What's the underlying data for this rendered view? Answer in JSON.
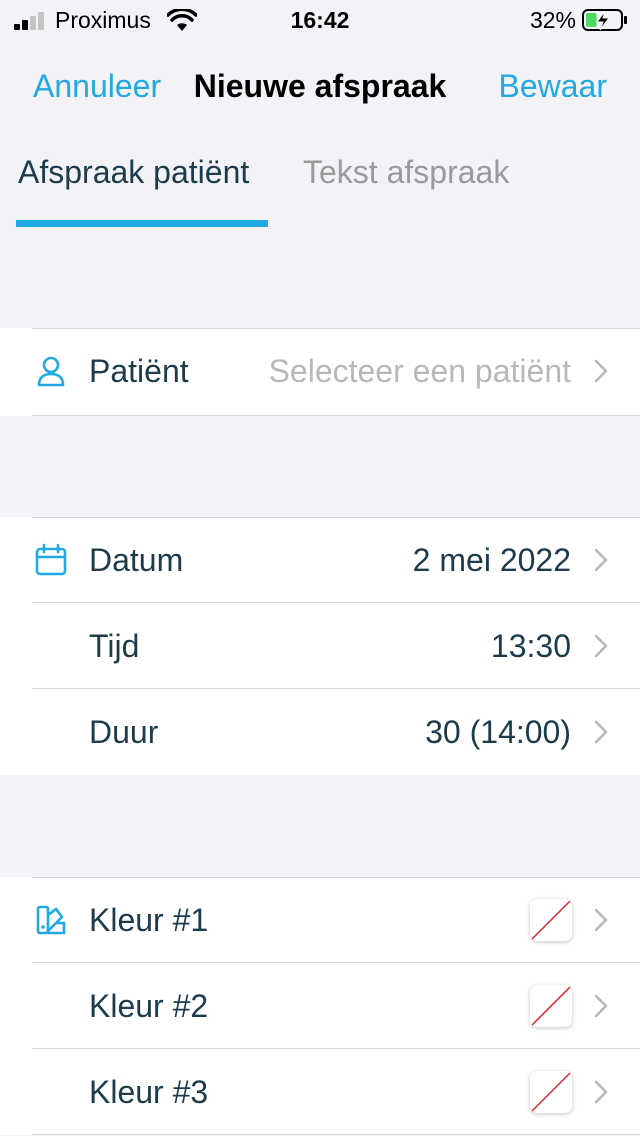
{
  "status": {
    "carrier": "Proximus",
    "time": "16:42",
    "battery": "32%",
    "battery_level": 0.32
  },
  "nav": {
    "cancel": "Annuleer",
    "title": "Nieuwe afspraak",
    "save": "Bewaar"
  },
  "tabs": [
    {
      "label": "Afspraak patiënt",
      "active": true
    },
    {
      "label": "Tekst afspraak",
      "active": false
    }
  ],
  "patient": {
    "label": "Patiënt",
    "placeholder": "Selecteer een patiënt"
  },
  "schedule": {
    "date": {
      "label": "Datum",
      "value": "2 mei 2022"
    },
    "time": {
      "label": "Tijd",
      "value": "13:30"
    },
    "duration": {
      "label": "Duur",
      "value": "30 (14:00)"
    }
  },
  "colors": [
    {
      "label": "Kleur #1"
    },
    {
      "label": "Kleur #2"
    },
    {
      "label": "Kleur #3"
    }
  ],
  "theme": {
    "accent": "#21a9e1",
    "text": "#1c3c4c",
    "background": "#f2f2f7"
  }
}
